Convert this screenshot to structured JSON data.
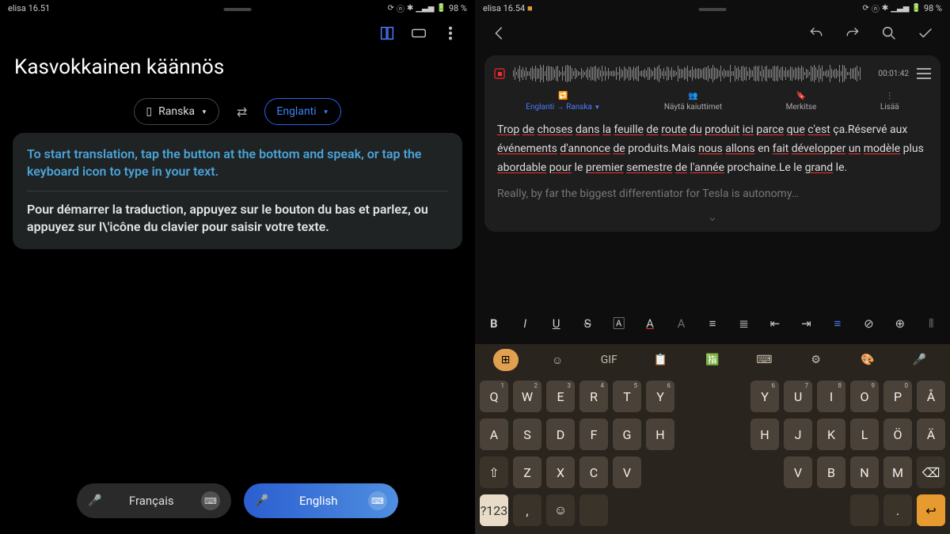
{
  "left": {
    "status": {
      "carrier": "elisa",
      "time": "16.51",
      "battery": "98 %"
    },
    "title": "Kasvokkainen käännös",
    "lang_src": "Ranska",
    "lang_tgt": "Englanti",
    "hint_en": "To start translation, tap the button at the bottom and speak, or tap the keyboard icon to type in your text.",
    "hint_fr": "Pour démarrer la traduction, appuyez sur le bouton du bas et parlez, ou appuyez sur l\\'icône du clavier pour saisir votre texte.",
    "speak_fr": "Français",
    "speak_en": "English"
  },
  "right": {
    "status": {
      "carrier": "elisa",
      "time": "16.54",
      "battery": "98 %"
    },
    "timer": "00:01:42",
    "tab_translate": "Englanti → Ranska",
    "tab_speakers": "Näytä kaiuttimet",
    "tab_bookmark": "Merkitse",
    "tab_more": "Lisää",
    "line1_words": [
      "Trop",
      "de",
      "choses",
      "dans",
      "la",
      "feuille",
      "de",
      "route",
      "du",
      "produit",
      "ici",
      "parce",
      "que",
      "c'est"
    ],
    "line1_tail": " ça.Réservé aux ",
    "line2_words": [
      "événements",
      "d'annonce",
      "de"
    ],
    "line2_mid": " produits.Mais ",
    "line2_words2": [
      "nous",
      "allons"
    ],
    "line2_mid2": " en ",
    "line2_words3": [
      "fait",
      "développer",
      "un",
      "modèle"
    ],
    "line3_pre": "plus ",
    "line3_words": [
      "abordable",
      "pour"
    ],
    "line3_mid": " le ",
    "line3_words2": [
      "premier",
      "semestre",
      "de",
      "l'année"
    ],
    "line3_mid2": " prochaine.Le le ",
    "line3_words3": [
      "grand"
    ],
    "line3_tail": " le.",
    "subtitle": "Really, by far the biggest differentiator for Tesla is autonomy…"
  },
  "fmt": {
    "b": "B",
    "i": "I",
    "u": "U"
  },
  "kbd": {
    "gif": "GIF",
    "row1": [
      [
        "Q",
        "1"
      ],
      [
        "W",
        "2"
      ],
      [
        "E",
        "3"
      ],
      [
        "R",
        "4"
      ],
      [
        "T",
        "5"
      ],
      [
        "Y",
        "6"
      ]
    ],
    "row1b": [
      [
        "Y",
        "6"
      ],
      [
        "U",
        "7"
      ],
      [
        "I",
        "8"
      ],
      [
        "O",
        "9"
      ],
      [
        "P",
        "0"
      ],
      [
        "Å",
        ""
      ]
    ],
    "row2": [
      "A",
      "S",
      "D",
      "F",
      "G",
      "H"
    ],
    "row2b": [
      "H",
      "J",
      "K",
      "L",
      "Ö",
      "Ä"
    ],
    "row3": [
      "Z",
      "X",
      "C",
      "V"
    ],
    "row3b": [
      "V",
      "B",
      "N",
      "M"
    ],
    "sym": "?123",
    "comma": ",",
    "period": "."
  }
}
